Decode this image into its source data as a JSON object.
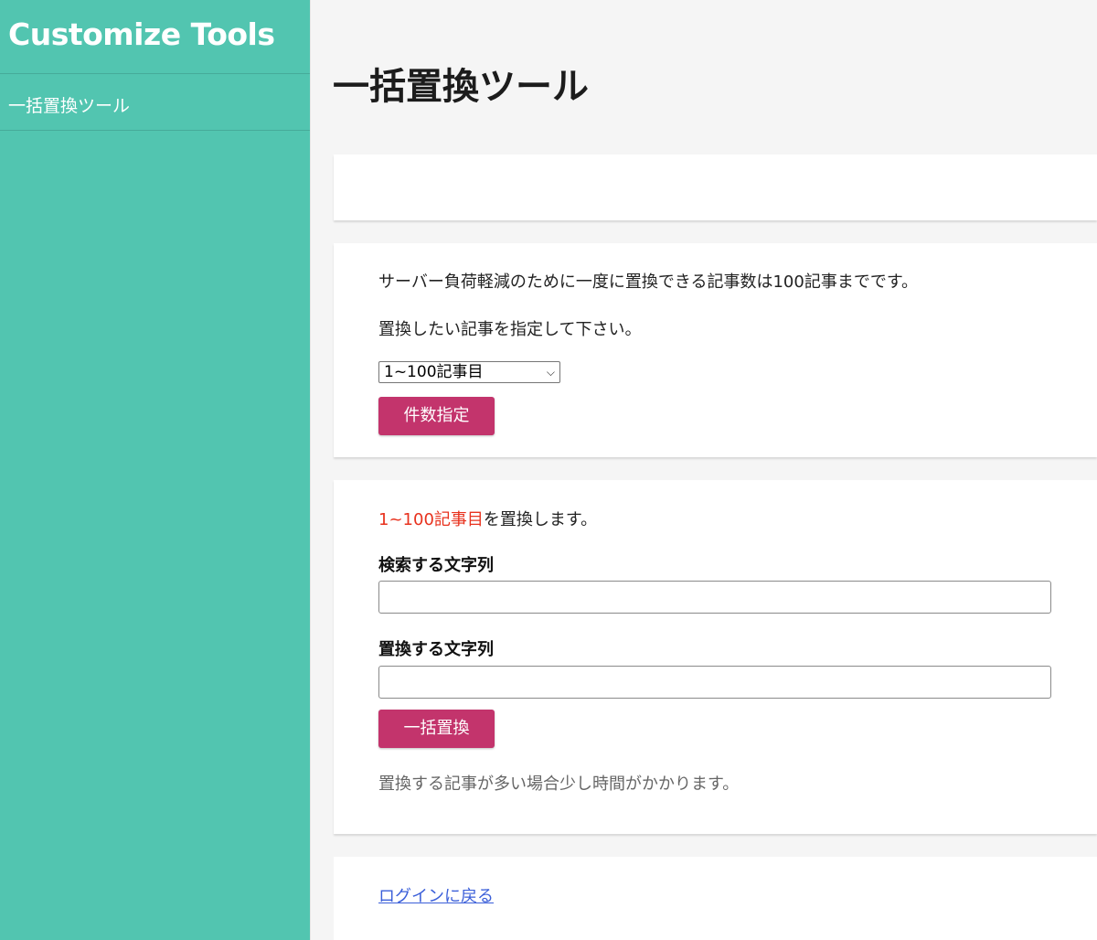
{
  "sidebar": {
    "brand": "Customize Tools",
    "items": [
      {
        "label": "一括置換ツール"
      }
    ]
  },
  "main": {
    "title": "一括置換ツール",
    "select_section": {
      "notice": "サーバー負荷軽減のために一度に置換できる記事数は100記事までです。",
      "instruction": "置換したい記事を指定して下さい。",
      "select_value": "1~100記事目",
      "button_label": "件数指定"
    },
    "replace_section": {
      "range": "1~100記事目",
      "range_suffix": "を置換します。",
      "search_label": "検索する文字列",
      "search_value": "",
      "replace_label": "置換する文字列",
      "replace_value": "",
      "button_label": "一括置換",
      "note": "置換する記事が多い場合少し時間がかかります。"
    },
    "footer": {
      "back_link": "ログインに戻る"
    }
  },
  "colors": {
    "sidebar_bg": "#52c5b0",
    "button_bg": "#c3346c",
    "highlight": "#e8321e",
    "link": "#3b5fd9"
  }
}
